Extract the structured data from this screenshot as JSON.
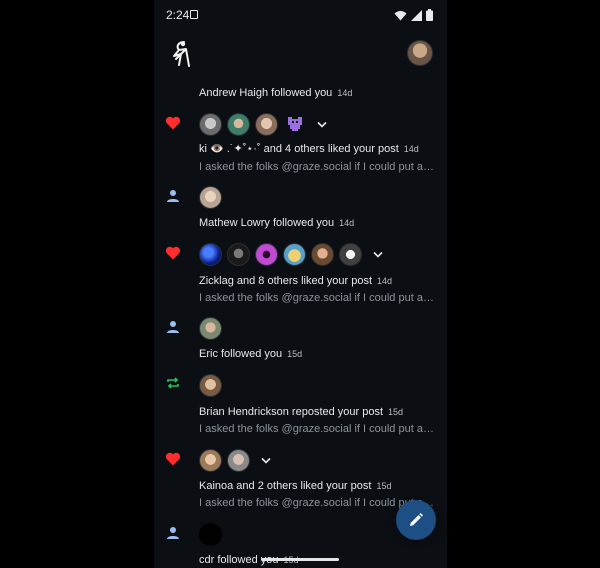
{
  "status_bar": {
    "time": "2:24"
  },
  "colors": {
    "like": "#ff2d2d",
    "follow": "#9dbdf0",
    "repost": "#22c55e",
    "fab": "#1d4f85"
  },
  "notifications": [
    {
      "type": "follow",
      "title": "Andrew Haigh followed you",
      "time": "14d",
      "avatars": []
    },
    {
      "type": "like",
      "title": "ki 👁️ .˙✦˚⋆·˚ and 4 others liked your post",
      "time": "14d",
      "preview": "I asked the folks @graze.social if I could put a feed on the front page",
      "avatars": [
        "portrait-gray",
        "portrait-green",
        "portrait-bald",
        "pixel-purple"
      ],
      "expandable": true
    },
    {
      "type": "follow",
      "title": "Mathew Lowry followed you",
      "time": "14d",
      "avatars": [
        "portrait-light"
      ]
    },
    {
      "type": "like",
      "title": "Zicklag and 8 others liked your post",
      "time": "14d",
      "preview": "I asked the folks @graze.social if I could put a feed on the front page",
      "avatars": [
        "blue-abstract",
        "dark-portrait",
        "pink-purple",
        "dog-cartoon",
        "bearded-man",
        "robot-face"
      ],
      "expandable": true
    },
    {
      "type": "follow",
      "title": "Eric followed you",
      "time": "15d",
      "avatars": [
        "portrait-outdoor"
      ]
    },
    {
      "type": "repost",
      "title": "Brian Hendrickson reposted your post",
      "time": "15d",
      "preview": "I asked the folks @graze.social if I could put a feed on the front page",
      "avatars": [
        "portrait-brown"
      ]
    },
    {
      "type": "like",
      "title": "Kainoa and 2 others liked your post",
      "time": "15d",
      "preview": "I asked the folks @graze.social if I could put a feed on the front page",
      "avatars": [
        "portrait-curly",
        "portrait-gray2"
      ],
      "expandable": true
    },
    {
      "type": "follow",
      "title": "cdr followed you",
      "time": "15d",
      "avatars": [
        "black"
      ]
    }
  ]
}
